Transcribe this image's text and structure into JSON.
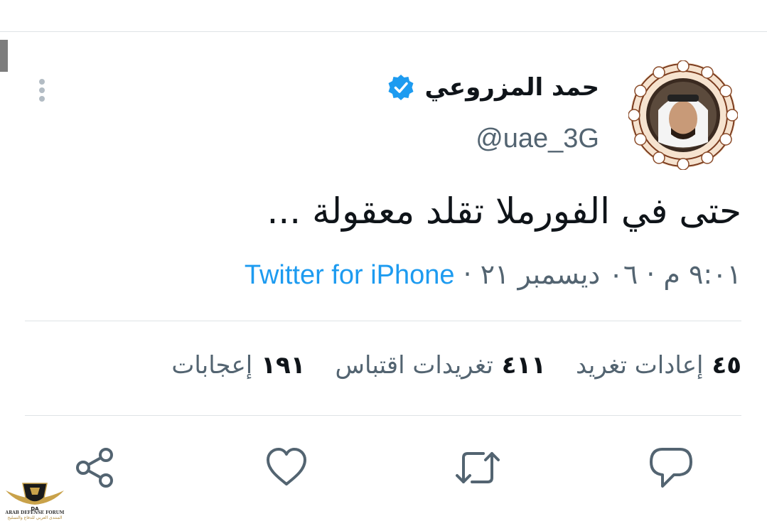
{
  "tweet": {
    "display_name": "حمد المزروعي",
    "handle": "@uae_3G",
    "text": "حتى في الفورملا تقلد معقولة ...",
    "time": "٩:٠١ م",
    "date": "٠٦ ديسمبر ٢١",
    "separator": "·",
    "source": "Twitter for iPhone"
  },
  "stats": {
    "retweets": {
      "count": "٤٥",
      "label": "إعادات تغريد"
    },
    "quotes": {
      "count": "٤١١",
      "label": "تغريدات اقتباس"
    },
    "likes": {
      "count": "١٩١",
      "label": "إعجابات"
    }
  },
  "icons": {
    "more": "vertical-dots-icon",
    "verified": "verified-badge-icon",
    "reply": "reply-bubble-icon",
    "retweet": "retweet-icon",
    "like": "heart-icon",
    "share": "share-icon"
  },
  "watermark": {
    "title": "ARAB DEFENSE FORUM",
    "subtitle": "المنتدى العربي للدفاع والتسليح"
  },
  "colors": {
    "accent": "#1d9bf0",
    "secondary_text": "#536471",
    "icon_gray": "#536471"
  }
}
